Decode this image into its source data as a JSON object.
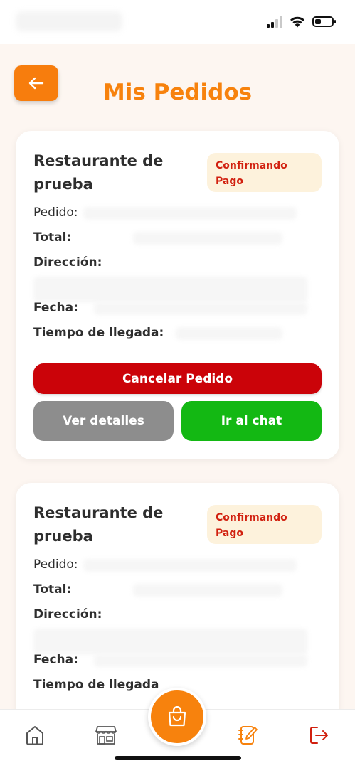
{
  "header": {
    "back_icon": "arrow-left-icon",
    "title": "Mis Pedidos"
  },
  "orders": [
    {
      "restaurant": "Restaurante de prueba",
      "status": "Confirmando Pago",
      "labels": {
        "order": "Pedido:",
        "total": "Total:",
        "address": "Dirección:",
        "date": "Fecha:",
        "arrival": "Tiempo de llegada:"
      },
      "actions": {
        "cancel": "Cancelar Pedido",
        "details": "Ver detalles",
        "chat": "Ir al chat"
      }
    },
    {
      "restaurant": "Restaurante de prueba",
      "status": "Confirmando Pago",
      "labels": {
        "order": "Pedido:",
        "total": "Total:",
        "address": "Dirección:",
        "date": "Fecha:",
        "arrival": "Tiempo de llegada"
      }
    }
  ],
  "bottom_nav": {
    "items": [
      "home-icon",
      "store-icon",
      "orders-icon",
      "logout-icon"
    ],
    "active": "orders-icon",
    "center_button": "shopping-bag-icon"
  },
  "colors": {
    "accent": "#f7820d",
    "cancel": "#cb0309",
    "details": "#8d8d8d",
    "chat": "#13b813",
    "status_text": "#d1200f",
    "status_bg": "#fdf2dc",
    "background": "#fdf6f1"
  }
}
